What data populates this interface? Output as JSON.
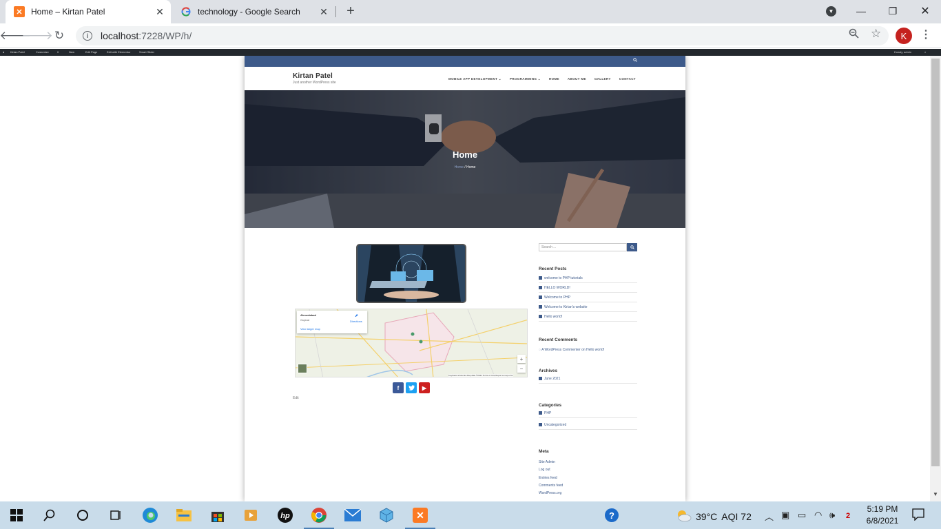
{
  "browser": {
    "tabs": [
      {
        "title": "Home – Kirtan Patel",
        "favicon": "xampp-icon",
        "active": true
      },
      {
        "title": "technology - Google Search",
        "favicon": "google-icon",
        "active": false
      }
    ],
    "new_tab_symbol": "+",
    "url_host": "localhost",
    "url_rest": ":7228/WP/h/",
    "profile_initial": "K"
  },
  "adminbar": {
    "items": [
      "Kirtan Patel",
      "Customize",
      "0",
      "New",
      "Edit Page",
      "Edit with Elementor",
      "Smart Slider"
    ],
    "greeting": "Howdy, admin"
  },
  "site": {
    "title": "Kirtan Patel",
    "tagline": "Just another WordPress site",
    "menu": [
      "MOBILE APP DEVELOPMENT ⌄",
      "PROGRAMMING ⌄",
      "HOME",
      "ABOUT ME",
      "GALLERY",
      "CONTACT"
    ],
    "hero_title": "Home",
    "breadcrumb_prev": "Home",
    "breadcrumb_sep": "/",
    "breadcrumb_current": "Home"
  },
  "map": {
    "place": "Ahmedabad",
    "region": "Gujarat",
    "directions": "Directions",
    "larger_map": "View larger map",
    "footer": "Keyboard shortcuts   Map data ©2021   Terms of Use   Report a map error"
  },
  "content": {
    "edit_link": "Edit"
  },
  "sidebar": {
    "search_placeholder": "Search ...",
    "recent_posts_title": "Recent Posts",
    "recent_posts": [
      "welcome to PHP tutorials",
      "HELLO WORLD!",
      "Welcome to PHP",
      "Welcome to Kirtan's website",
      "Hello world!"
    ],
    "recent_comments_title": "Recent Comments",
    "recent_comment": "A WordPress Commenter on Hello world!",
    "archives_title": "Archives",
    "archives": [
      "June 2021"
    ],
    "categories_title": "Categories",
    "categories": [
      "PHP",
      "Uncategorized"
    ],
    "meta_title": "Meta",
    "meta": [
      "Site Admin",
      "Log out",
      "Entries feed",
      "Comments feed",
      "WordPress.org"
    ]
  },
  "taskbar": {
    "temperature": "39°C",
    "aqi": "AQI 72",
    "time": "5:19 PM",
    "date": "6/8/2021",
    "notification_badge": "2"
  },
  "colors": {
    "brand_blue": "#3d5a8a",
    "facebook": "#3b5998",
    "twitter": "#1da1f2",
    "youtube": "#cd201f"
  }
}
